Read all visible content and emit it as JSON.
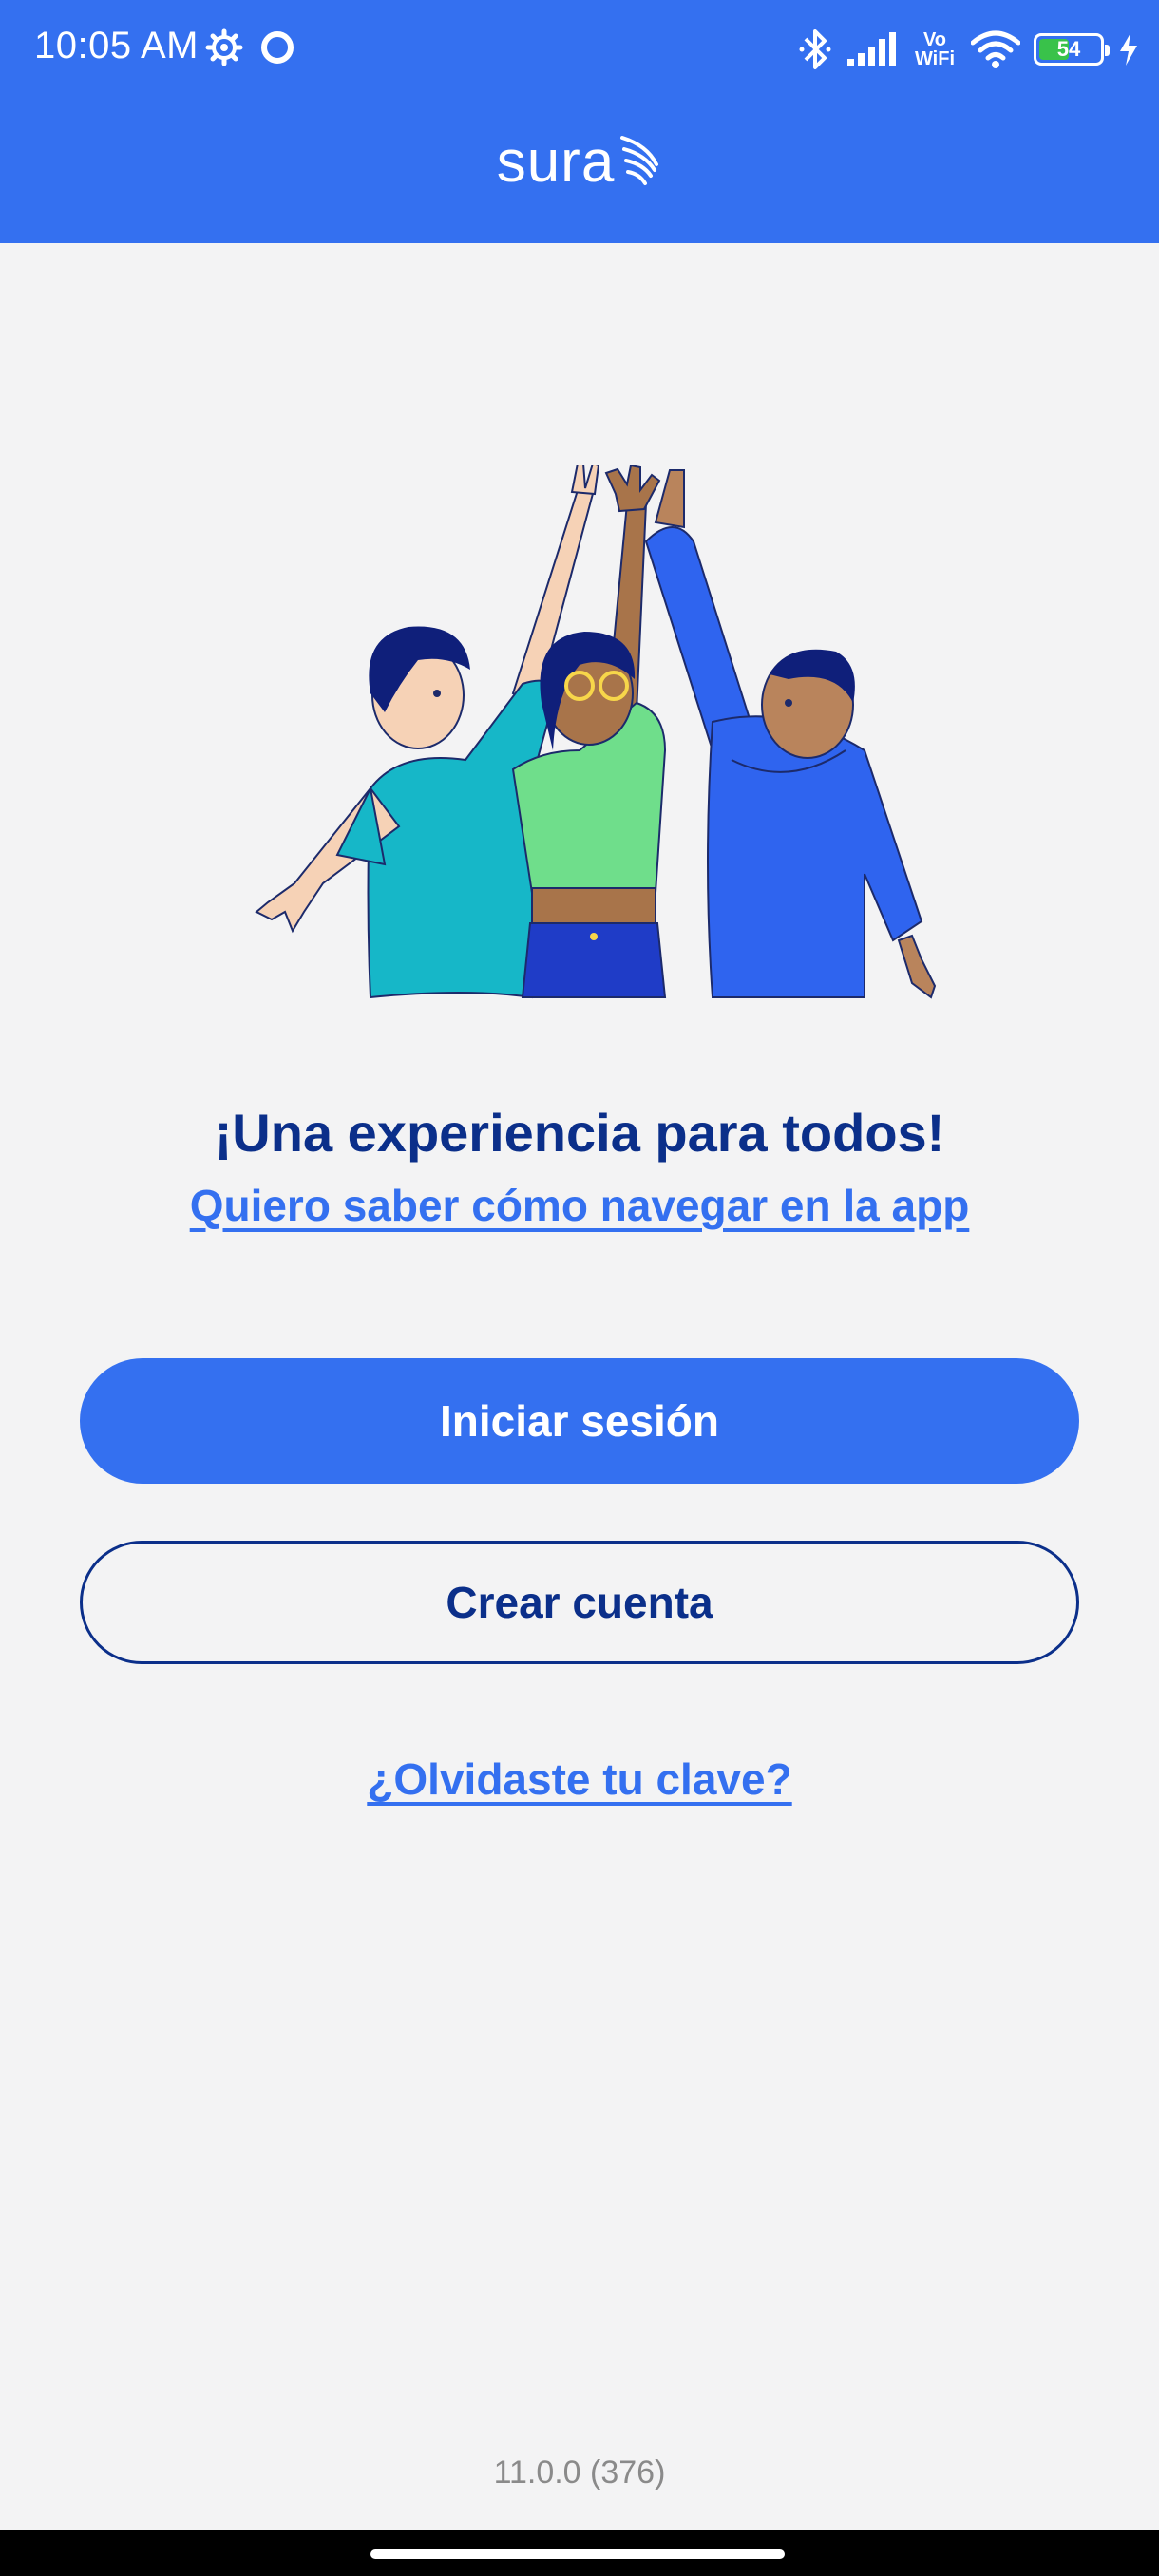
{
  "status_bar": {
    "time": "10:05 AM",
    "vowifi_top": "Vo",
    "vowifi_bottom": "WiFi",
    "battery_level": "54",
    "battery_fraction": 0.54,
    "icons": [
      "gear-icon",
      "circle-icon",
      "bluetooth-icon",
      "signal-icon",
      "vowifi-icon",
      "wifi-icon",
      "battery-icon",
      "charging-bolt-icon"
    ]
  },
  "header": {
    "brand": "sura",
    "color": "#3470f0"
  },
  "main": {
    "headline": "¡Una experiencia para todos!",
    "nav_link": "Quiero saber cómo navegar en la app",
    "login_label": "Iniciar sesión",
    "create_label": "Crear cuenta",
    "forgot_label": "¿Olvidaste tu clave?"
  },
  "footer": {
    "version": "11.0.0 (376)"
  },
  "colors": {
    "primary": "#3470f0",
    "dark_blue": "#0b2f8a",
    "background": "#f3f3f4"
  }
}
